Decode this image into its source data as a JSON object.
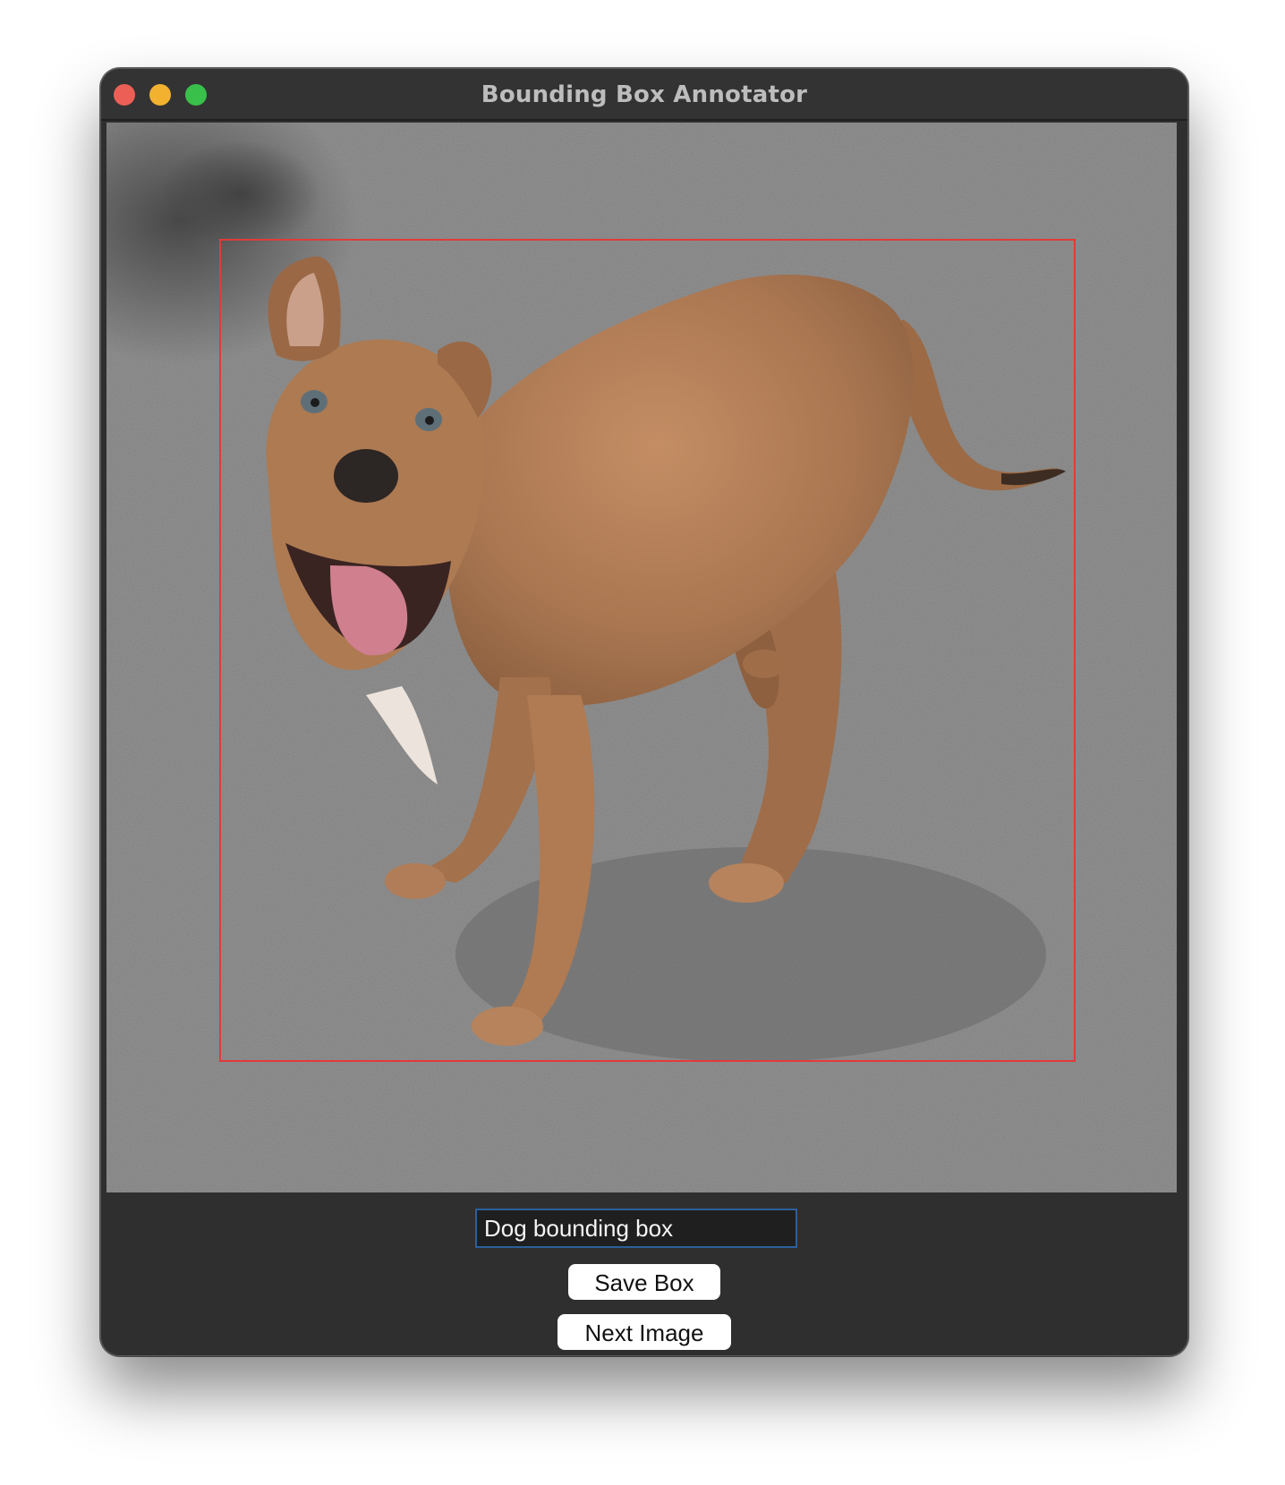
{
  "window": {
    "title": "Bounding Box Annotator"
  },
  "canvas": {
    "image_subject": "dog",
    "box_color": "#e33a3a"
  },
  "controls": {
    "label_value": "Dog bounding box",
    "save_label": "Save Box",
    "next_label": "Next Image"
  },
  "colors": {
    "window_bg": "#2f2f2f",
    "titlebar_bg": "#333333",
    "close": "#ec5f56",
    "minimize": "#f2b12f",
    "zoom": "#39c04a",
    "input_border": "#2d5f9c"
  }
}
